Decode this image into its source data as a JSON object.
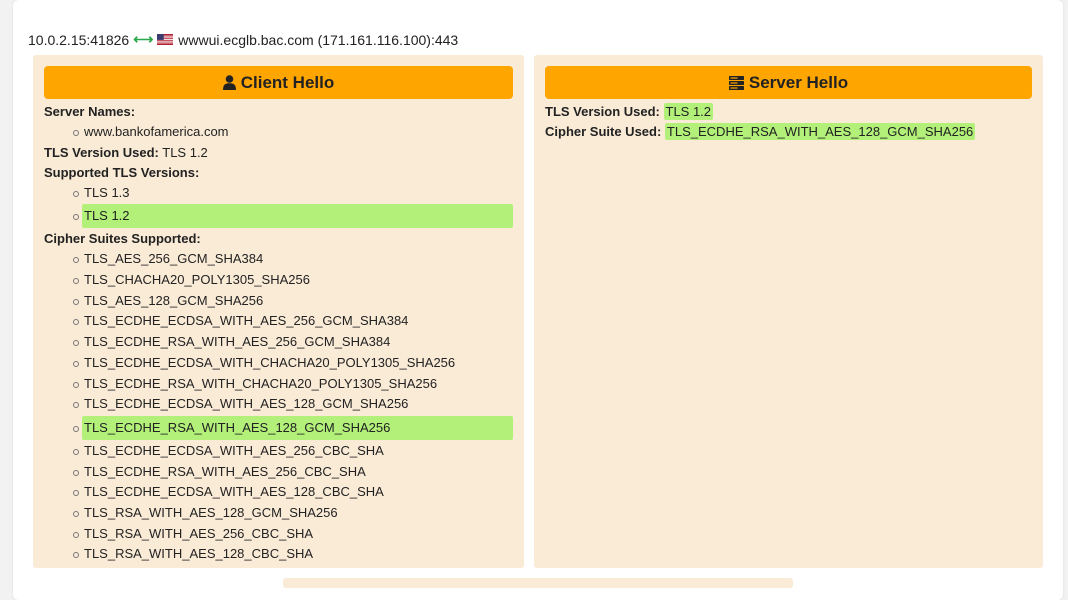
{
  "connection": {
    "source": "10.0.2.15:41826",
    "arrow": "⟷",
    "destination": "wwwui.ecglb.bac.com (171.161.116.100):443"
  },
  "client_hello": {
    "title": "Client Hello",
    "server_names_label": "Server Names:",
    "server_names": [
      "www.bankofamerica.com"
    ],
    "tls_version_label": "TLS Version Used:",
    "tls_version": "TLS 1.2",
    "supported_versions_label": "Supported TLS Versions:",
    "supported_versions": [
      "TLS 1.3",
      "TLS 1.2"
    ],
    "cipher_suites_label": "Cipher Suites Supported:",
    "cipher_suites": [
      "TLS_AES_256_GCM_SHA384",
      "TLS_CHACHA20_POLY1305_SHA256",
      "TLS_AES_128_GCM_SHA256",
      "TLS_ECDHE_ECDSA_WITH_AES_256_GCM_SHA384",
      "TLS_ECDHE_RSA_WITH_AES_256_GCM_SHA384",
      "TLS_ECDHE_ECDSA_WITH_CHACHA20_POLY1305_SHA256",
      "TLS_ECDHE_RSA_WITH_CHACHA20_POLY1305_SHA256",
      "TLS_ECDHE_ECDSA_WITH_AES_128_GCM_SHA256",
      "TLS_ECDHE_RSA_WITH_AES_128_GCM_SHA256",
      "TLS_ECDHE_ECDSA_WITH_AES_256_CBC_SHA",
      "TLS_ECDHE_RSA_WITH_AES_256_CBC_SHA",
      "TLS_ECDHE_ECDSA_WITH_AES_128_CBC_SHA",
      "TLS_RSA_WITH_AES_128_GCM_SHA256",
      "TLS_RSA_WITH_AES_256_CBC_SHA",
      "TLS_RSA_WITH_AES_128_CBC_SHA"
    ]
  },
  "server_hello": {
    "title": "Server Hello",
    "tls_version_label": "TLS Version Used:",
    "tls_version": "TLS 1.2",
    "cipher_label": "Cipher Suite Used:",
    "cipher": "TLS_ECDHE_RSA_WITH_AES_128_GCM_SHA256"
  },
  "colors": {
    "panel_bg": "#faebd7",
    "header_bg": "#ffa500",
    "highlight": "#b3f07a"
  },
  "icons": {
    "client": "user-icon",
    "server": "server-icon",
    "flag": "us-flag-icon",
    "arrow": "double-arrow-icon"
  }
}
